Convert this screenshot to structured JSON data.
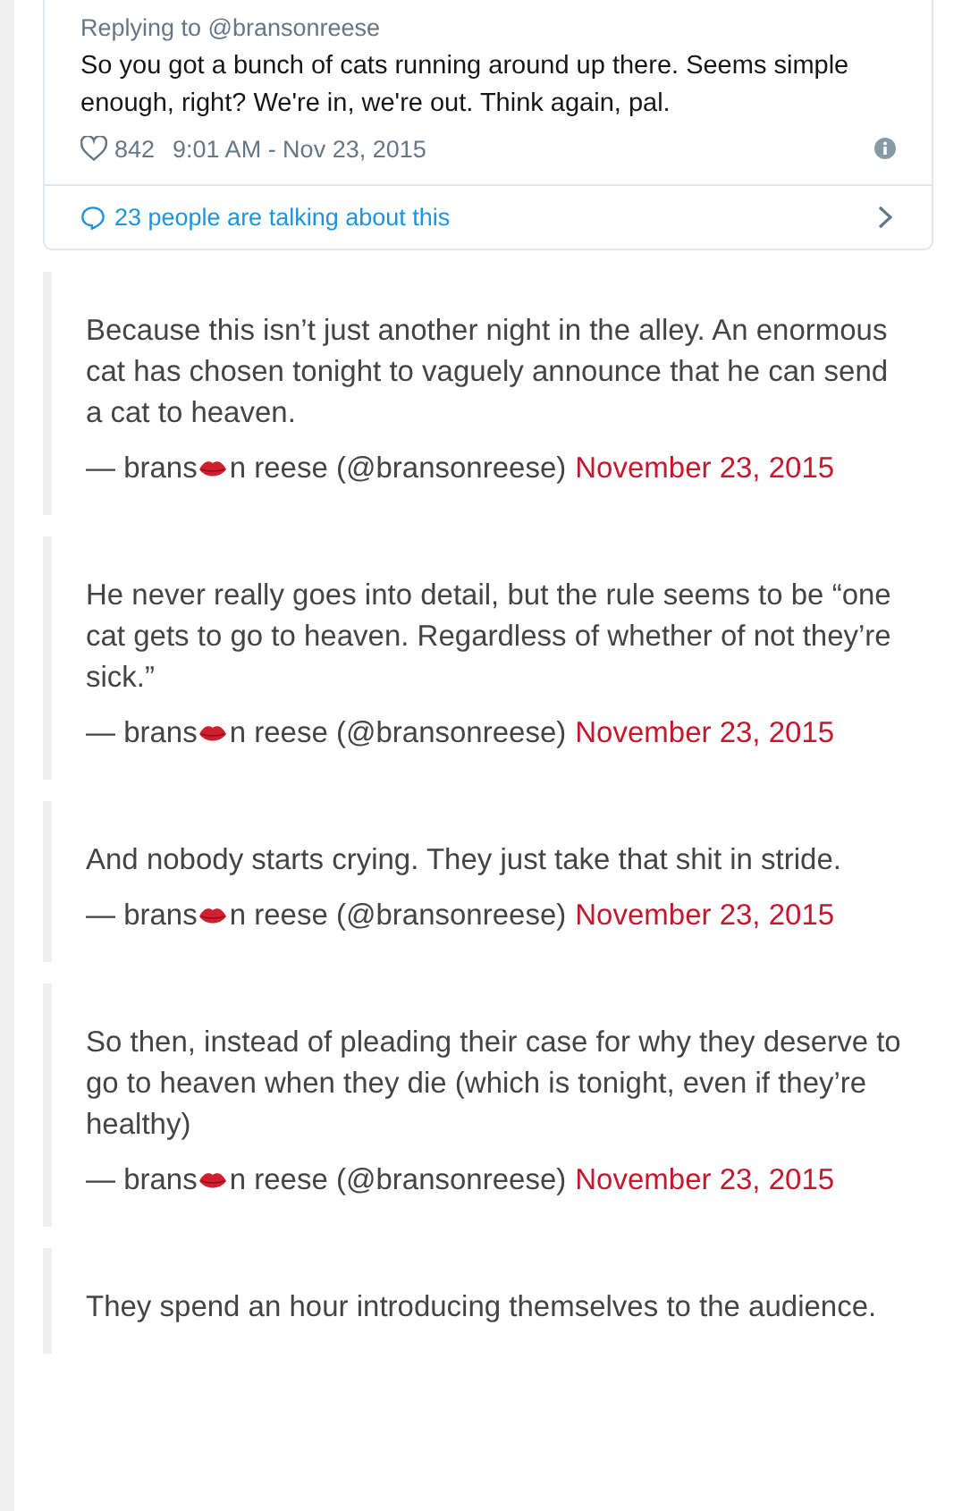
{
  "tweet": {
    "replying_to": "Replying to @bransonreese",
    "text": "So you got a bunch of cats running around up there. Seems simple enough, right? We're in, we're out. Think again, pal.",
    "likes": "842",
    "timestamp": "9:01 AM - Nov 23, 2015",
    "conversation": "23 people are talking about this"
  },
  "quotes": [
    {
      "text": "Because this isn’t just another night in the alley. An enormous cat has chosen tonight to vaguely announce that he can send a cat to heaven.",
      "author_start": "— brans",
      "author_end": "n reese (@bransonreese)",
      "date": "November 23, 2015"
    },
    {
      "text": "He never really goes into detail, but the rule seems to be “one cat gets to go to heaven. Regardless of whether of not they’re sick.”",
      "author_start": "— brans",
      "author_end": "n reese (@bransonreese)",
      "date": "November 23, 2015"
    },
    {
      "text": "And nobody starts crying. They just take that shit in stride.",
      "author_start": "— brans",
      "author_end": "n reese (@bransonreese)",
      "date": "November 23, 2015"
    },
    {
      "text": "So then, instead of pleading their case for why they deserve to go to heaven when they die (which is tonight, even if they’re healthy)",
      "author_start": "— brans",
      "author_end": "n reese (@bransonreese)",
      "date": "November 23, 2015"
    },
    {
      "text": "They spend an hour introducing themselves to the audience."
    }
  ]
}
